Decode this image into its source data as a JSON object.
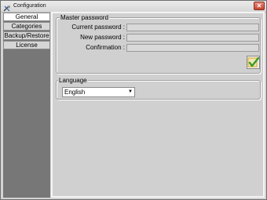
{
  "window": {
    "title": "Configuration",
    "close_glyph": "✕"
  },
  "tabs": [
    {
      "label": "General",
      "active": true
    },
    {
      "label": "Categories",
      "active": false
    },
    {
      "label": "Backup/Restore",
      "active": false
    },
    {
      "label": "License",
      "active": false
    }
  ],
  "master_password": {
    "legend": "Master password",
    "current_label": "Current password :",
    "new_label": "New password :",
    "confirm_label": "Confirmation :",
    "current_value": "",
    "new_value": "",
    "confirm_value": "",
    "ok_icon": "checkmark-icon"
  },
  "language": {
    "legend": "Language",
    "selected": "English"
  },
  "colors": {
    "checkmark_green": "#3a9a2a",
    "checkmark_accent": "#d7a41c",
    "close_red": "#c5442f"
  }
}
